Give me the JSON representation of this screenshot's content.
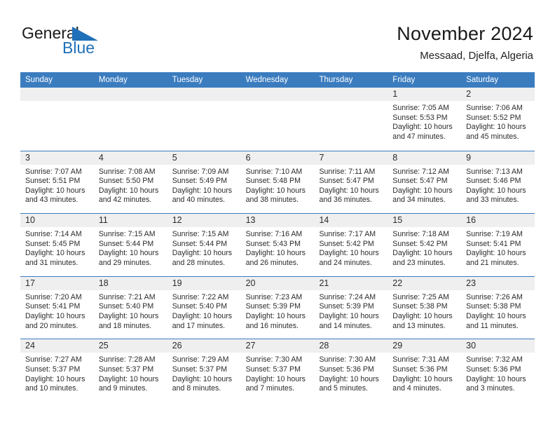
{
  "brand": {
    "name_part1": "General",
    "name_part2": "Blue",
    "icon": "triangle-flag-icon",
    "color_dark": "#1a1a1a",
    "color_blue": "#1f70b8"
  },
  "header": {
    "title": "November 2024",
    "subtitle": "Messaad, Djelfa, Algeria"
  },
  "colors": {
    "header_blue": "#3b7cbf",
    "day_band_gray": "#efefef",
    "text": "#2b2b2b"
  },
  "calendar": {
    "weekdays": [
      "Sunday",
      "Monday",
      "Tuesday",
      "Wednesday",
      "Thursday",
      "Friday",
      "Saturday"
    ],
    "labels": {
      "sunrise": "Sunrise:",
      "sunset": "Sunset:",
      "daylight": "Daylight:"
    },
    "weeks": [
      [
        {
          "day": "",
          "lines": []
        },
        {
          "day": "",
          "lines": []
        },
        {
          "day": "",
          "lines": []
        },
        {
          "day": "",
          "lines": []
        },
        {
          "day": "",
          "lines": []
        },
        {
          "day": "1",
          "lines": [
            "Sunrise: 7:05 AM",
            "Sunset: 5:53 PM",
            "Daylight: 10 hours",
            "and 47 minutes."
          ]
        },
        {
          "day": "2",
          "lines": [
            "Sunrise: 7:06 AM",
            "Sunset: 5:52 PM",
            "Daylight: 10 hours",
            "and 45 minutes."
          ]
        }
      ],
      [
        {
          "day": "3",
          "lines": [
            "Sunrise: 7:07 AM",
            "Sunset: 5:51 PM",
            "Daylight: 10 hours",
            "and 43 minutes."
          ]
        },
        {
          "day": "4",
          "lines": [
            "Sunrise: 7:08 AM",
            "Sunset: 5:50 PM",
            "Daylight: 10 hours",
            "and 42 minutes."
          ]
        },
        {
          "day": "5",
          "lines": [
            "Sunrise: 7:09 AM",
            "Sunset: 5:49 PM",
            "Daylight: 10 hours",
            "and 40 minutes."
          ]
        },
        {
          "day": "6",
          "lines": [
            "Sunrise: 7:10 AM",
            "Sunset: 5:48 PM",
            "Daylight: 10 hours",
            "and 38 minutes."
          ]
        },
        {
          "day": "7",
          "lines": [
            "Sunrise: 7:11 AM",
            "Sunset: 5:47 PM",
            "Daylight: 10 hours",
            "and 36 minutes."
          ]
        },
        {
          "day": "8",
          "lines": [
            "Sunrise: 7:12 AM",
            "Sunset: 5:47 PM",
            "Daylight: 10 hours",
            "and 34 minutes."
          ]
        },
        {
          "day": "9",
          "lines": [
            "Sunrise: 7:13 AM",
            "Sunset: 5:46 PM",
            "Daylight: 10 hours",
            "and 33 minutes."
          ]
        }
      ],
      [
        {
          "day": "10",
          "lines": [
            "Sunrise: 7:14 AM",
            "Sunset: 5:45 PM",
            "Daylight: 10 hours",
            "and 31 minutes."
          ]
        },
        {
          "day": "11",
          "lines": [
            "Sunrise: 7:15 AM",
            "Sunset: 5:44 PM",
            "Daylight: 10 hours",
            "and 29 minutes."
          ]
        },
        {
          "day": "12",
          "lines": [
            "Sunrise: 7:15 AM",
            "Sunset: 5:44 PM",
            "Daylight: 10 hours",
            "and 28 minutes."
          ]
        },
        {
          "day": "13",
          "lines": [
            "Sunrise: 7:16 AM",
            "Sunset: 5:43 PM",
            "Daylight: 10 hours",
            "and 26 minutes."
          ]
        },
        {
          "day": "14",
          "lines": [
            "Sunrise: 7:17 AM",
            "Sunset: 5:42 PM",
            "Daylight: 10 hours",
            "and 24 minutes."
          ]
        },
        {
          "day": "15",
          "lines": [
            "Sunrise: 7:18 AM",
            "Sunset: 5:42 PM",
            "Daylight: 10 hours",
            "and 23 minutes."
          ]
        },
        {
          "day": "16",
          "lines": [
            "Sunrise: 7:19 AM",
            "Sunset: 5:41 PM",
            "Daylight: 10 hours",
            "and 21 minutes."
          ]
        }
      ],
      [
        {
          "day": "17",
          "lines": [
            "Sunrise: 7:20 AM",
            "Sunset: 5:41 PM",
            "Daylight: 10 hours",
            "and 20 minutes."
          ]
        },
        {
          "day": "18",
          "lines": [
            "Sunrise: 7:21 AM",
            "Sunset: 5:40 PM",
            "Daylight: 10 hours",
            "and 18 minutes."
          ]
        },
        {
          "day": "19",
          "lines": [
            "Sunrise: 7:22 AM",
            "Sunset: 5:40 PM",
            "Daylight: 10 hours",
            "and 17 minutes."
          ]
        },
        {
          "day": "20",
          "lines": [
            "Sunrise: 7:23 AM",
            "Sunset: 5:39 PM",
            "Daylight: 10 hours",
            "and 16 minutes."
          ]
        },
        {
          "day": "21",
          "lines": [
            "Sunrise: 7:24 AM",
            "Sunset: 5:39 PM",
            "Daylight: 10 hours",
            "and 14 minutes."
          ]
        },
        {
          "day": "22",
          "lines": [
            "Sunrise: 7:25 AM",
            "Sunset: 5:38 PM",
            "Daylight: 10 hours",
            "and 13 minutes."
          ]
        },
        {
          "day": "23",
          "lines": [
            "Sunrise: 7:26 AM",
            "Sunset: 5:38 PM",
            "Daylight: 10 hours",
            "and 11 minutes."
          ]
        }
      ],
      [
        {
          "day": "24",
          "lines": [
            "Sunrise: 7:27 AM",
            "Sunset: 5:37 PM",
            "Daylight: 10 hours",
            "and 10 minutes."
          ]
        },
        {
          "day": "25",
          "lines": [
            "Sunrise: 7:28 AM",
            "Sunset: 5:37 PM",
            "Daylight: 10 hours",
            "and 9 minutes."
          ]
        },
        {
          "day": "26",
          "lines": [
            "Sunrise: 7:29 AM",
            "Sunset: 5:37 PM",
            "Daylight: 10 hours",
            "and 8 minutes."
          ]
        },
        {
          "day": "27",
          "lines": [
            "Sunrise: 7:30 AM",
            "Sunset: 5:37 PM",
            "Daylight: 10 hours",
            "and 7 minutes."
          ]
        },
        {
          "day": "28",
          "lines": [
            "Sunrise: 7:30 AM",
            "Sunset: 5:36 PM",
            "Daylight: 10 hours",
            "and 5 minutes."
          ]
        },
        {
          "day": "29",
          "lines": [
            "Sunrise: 7:31 AM",
            "Sunset: 5:36 PM",
            "Daylight: 10 hours",
            "and 4 minutes."
          ]
        },
        {
          "day": "30",
          "lines": [
            "Sunrise: 7:32 AM",
            "Sunset: 5:36 PM",
            "Daylight: 10 hours",
            "and 3 minutes."
          ]
        }
      ]
    ]
  }
}
